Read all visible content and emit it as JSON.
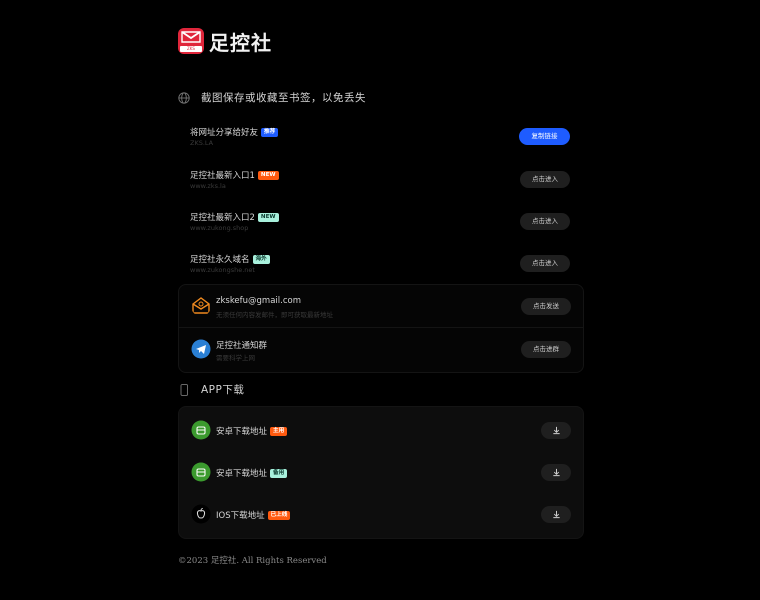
{
  "brand": {
    "name": "足控社",
    "mark_tag": "ZKS",
    "color": "#e0263b"
  },
  "notice": {
    "text": "截图保存或收藏至书签，以免丢失"
  },
  "links": [
    {
      "title": "将网址分享给好友",
      "badge": "推荐",
      "badge_style": "blue",
      "sub": "ZKS.LA",
      "button": "复制链接",
      "primary": true
    },
    {
      "title": "足控社最新入口1",
      "badge": "NEW",
      "badge_style": "orange",
      "sub": "www.zks.la",
      "button": "点击进入",
      "primary": false
    },
    {
      "title": "足控社最新入口2",
      "badge": "NEW",
      "badge_style": "mint",
      "sub": "www.zukong.shop",
      "button": "点击进入",
      "primary": false
    },
    {
      "title": "足控社永久域名",
      "badge": "海外",
      "badge_style": "mint",
      "sub": "www.zukongshe.net",
      "button": "点击进入",
      "primary": false
    }
  ],
  "contact": [
    {
      "title": "zkskefu@gmail.com",
      "sub": "无须任何内容发邮件，即可获取最新地址",
      "button": "点击发送",
      "icon": "mail-icon"
    },
    {
      "title": "足控社通知群",
      "sub": "需要科学上网",
      "button": "点击进群",
      "icon": "telegram-icon"
    }
  ],
  "app_section": {
    "title": "APP下载"
  },
  "downloads": [
    {
      "title": "安卓下载地址",
      "badge": "主用",
      "badge_style": "orange",
      "icon": "android-icon"
    },
    {
      "title": "安卓下载地址",
      "badge": "备用",
      "badge_style": "mint",
      "icon": "android-icon"
    },
    {
      "title": "IOS下载地址",
      "badge": "已上线",
      "badge_style": "orange",
      "icon": "apple-icon"
    }
  ],
  "footer": {
    "text": "©2023 足控社. All Rights Reserved"
  },
  "colors": {
    "primary": "#1e5cff",
    "orange": "#ff5a0f",
    "mint": "#a8f0dc",
    "android": "#3b9a2e",
    "telegram": "#2a7fd4",
    "mail": "#f08a1f"
  }
}
